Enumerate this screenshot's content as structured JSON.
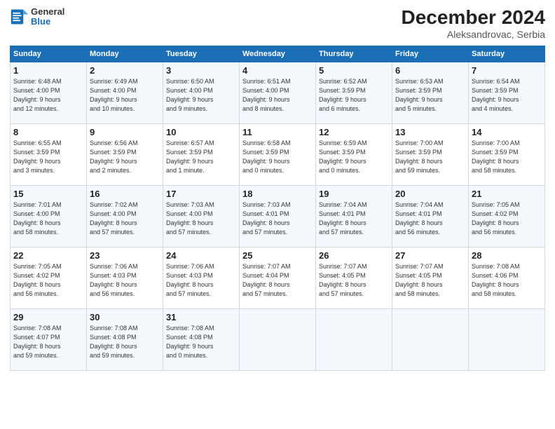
{
  "header": {
    "logo_line1": "General",
    "logo_line2": "Blue",
    "title": "December 2024",
    "subtitle": "Aleksandrovac, Serbia"
  },
  "columns": [
    "Sunday",
    "Monday",
    "Tuesday",
    "Wednesday",
    "Thursday",
    "Friday",
    "Saturday"
  ],
  "weeks": [
    [
      {
        "day": "1",
        "info": "Sunrise: 6:48 AM\nSunset: 4:00 PM\nDaylight: 9 hours\nand 12 minutes."
      },
      {
        "day": "2",
        "info": "Sunrise: 6:49 AM\nSunset: 4:00 PM\nDaylight: 9 hours\nand 10 minutes."
      },
      {
        "day": "3",
        "info": "Sunrise: 6:50 AM\nSunset: 4:00 PM\nDaylight: 9 hours\nand 9 minutes."
      },
      {
        "day": "4",
        "info": "Sunrise: 6:51 AM\nSunset: 4:00 PM\nDaylight: 9 hours\nand 8 minutes."
      },
      {
        "day": "5",
        "info": "Sunrise: 6:52 AM\nSunset: 3:59 PM\nDaylight: 9 hours\nand 6 minutes."
      },
      {
        "day": "6",
        "info": "Sunrise: 6:53 AM\nSunset: 3:59 PM\nDaylight: 9 hours\nand 5 minutes."
      },
      {
        "day": "7",
        "info": "Sunrise: 6:54 AM\nSunset: 3:59 PM\nDaylight: 9 hours\nand 4 minutes."
      }
    ],
    [
      {
        "day": "8",
        "info": "Sunrise: 6:55 AM\nSunset: 3:59 PM\nDaylight: 9 hours\nand 3 minutes."
      },
      {
        "day": "9",
        "info": "Sunrise: 6:56 AM\nSunset: 3:59 PM\nDaylight: 9 hours\nand 2 minutes."
      },
      {
        "day": "10",
        "info": "Sunrise: 6:57 AM\nSunset: 3:59 PM\nDaylight: 9 hours\nand 1 minute."
      },
      {
        "day": "11",
        "info": "Sunrise: 6:58 AM\nSunset: 3:59 PM\nDaylight: 9 hours\nand 0 minutes."
      },
      {
        "day": "12",
        "info": "Sunrise: 6:59 AM\nSunset: 3:59 PM\nDaylight: 9 hours\nand 0 minutes."
      },
      {
        "day": "13",
        "info": "Sunrise: 7:00 AM\nSunset: 3:59 PM\nDaylight: 8 hours\nand 59 minutes."
      },
      {
        "day": "14",
        "info": "Sunrise: 7:00 AM\nSunset: 3:59 PM\nDaylight: 8 hours\nand 58 minutes."
      }
    ],
    [
      {
        "day": "15",
        "info": "Sunrise: 7:01 AM\nSunset: 4:00 PM\nDaylight: 8 hours\nand 58 minutes."
      },
      {
        "day": "16",
        "info": "Sunrise: 7:02 AM\nSunset: 4:00 PM\nDaylight: 8 hours\nand 57 minutes."
      },
      {
        "day": "17",
        "info": "Sunrise: 7:03 AM\nSunset: 4:00 PM\nDaylight: 8 hours\nand 57 minutes."
      },
      {
        "day": "18",
        "info": "Sunrise: 7:03 AM\nSunset: 4:01 PM\nDaylight: 8 hours\nand 57 minutes."
      },
      {
        "day": "19",
        "info": "Sunrise: 7:04 AM\nSunset: 4:01 PM\nDaylight: 8 hours\nand 57 minutes."
      },
      {
        "day": "20",
        "info": "Sunrise: 7:04 AM\nSunset: 4:01 PM\nDaylight: 8 hours\nand 56 minutes."
      },
      {
        "day": "21",
        "info": "Sunrise: 7:05 AM\nSunset: 4:02 PM\nDaylight: 8 hours\nand 56 minutes."
      }
    ],
    [
      {
        "day": "22",
        "info": "Sunrise: 7:05 AM\nSunset: 4:02 PM\nDaylight: 8 hours\nand 56 minutes."
      },
      {
        "day": "23",
        "info": "Sunrise: 7:06 AM\nSunset: 4:03 PM\nDaylight: 8 hours\nand 56 minutes."
      },
      {
        "day": "24",
        "info": "Sunrise: 7:06 AM\nSunset: 4:03 PM\nDaylight: 8 hours\nand 57 minutes."
      },
      {
        "day": "25",
        "info": "Sunrise: 7:07 AM\nSunset: 4:04 PM\nDaylight: 8 hours\nand 57 minutes."
      },
      {
        "day": "26",
        "info": "Sunrise: 7:07 AM\nSunset: 4:05 PM\nDaylight: 8 hours\nand 57 minutes."
      },
      {
        "day": "27",
        "info": "Sunrise: 7:07 AM\nSunset: 4:05 PM\nDaylight: 8 hours\nand 58 minutes."
      },
      {
        "day": "28",
        "info": "Sunrise: 7:08 AM\nSunset: 4:06 PM\nDaylight: 8 hours\nand 58 minutes."
      }
    ],
    [
      {
        "day": "29",
        "info": "Sunrise: 7:08 AM\nSunset: 4:07 PM\nDaylight: 8 hours\nand 59 minutes."
      },
      {
        "day": "30",
        "info": "Sunrise: 7:08 AM\nSunset: 4:08 PM\nDaylight: 8 hours\nand 59 minutes."
      },
      {
        "day": "31",
        "info": "Sunrise: 7:08 AM\nSunset: 4:08 PM\nDaylight: 9 hours\nand 0 minutes."
      },
      {
        "day": "",
        "info": ""
      },
      {
        "day": "",
        "info": ""
      },
      {
        "day": "",
        "info": ""
      },
      {
        "day": "",
        "info": ""
      }
    ]
  ]
}
